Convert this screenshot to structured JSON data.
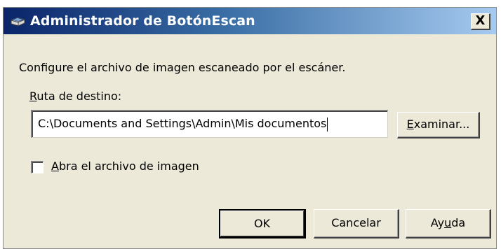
{
  "window": {
    "title": "Administrador de BotónEscan",
    "close_label": "X",
    "app_icon": "scanner-icon"
  },
  "content": {
    "intro": "Configure el archivo de imagen escaneado por el escáner.",
    "destination": {
      "label_mnemonic": "R",
      "label_rest": "uta de destino:",
      "value": "C:\\Documents and Settings\\Admin\\Mis documentos"
    },
    "browse_button": {
      "mnemonic": "E",
      "rest": "xaminar..."
    },
    "open_image_checkbox": {
      "mnemonic": "A",
      "rest": "bra el archivo de imagen",
      "checked": false
    }
  },
  "buttons": {
    "ok": "OK",
    "cancel": "Cancelar",
    "help_before": "Ay",
    "help_mnemonic": "u",
    "help_after": "da"
  },
  "colors": {
    "titlebar_start": "#0a246a",
    "titlebar_end": "#a6caf0",
    "dialog_face": "#ece9d8"
  }
}
